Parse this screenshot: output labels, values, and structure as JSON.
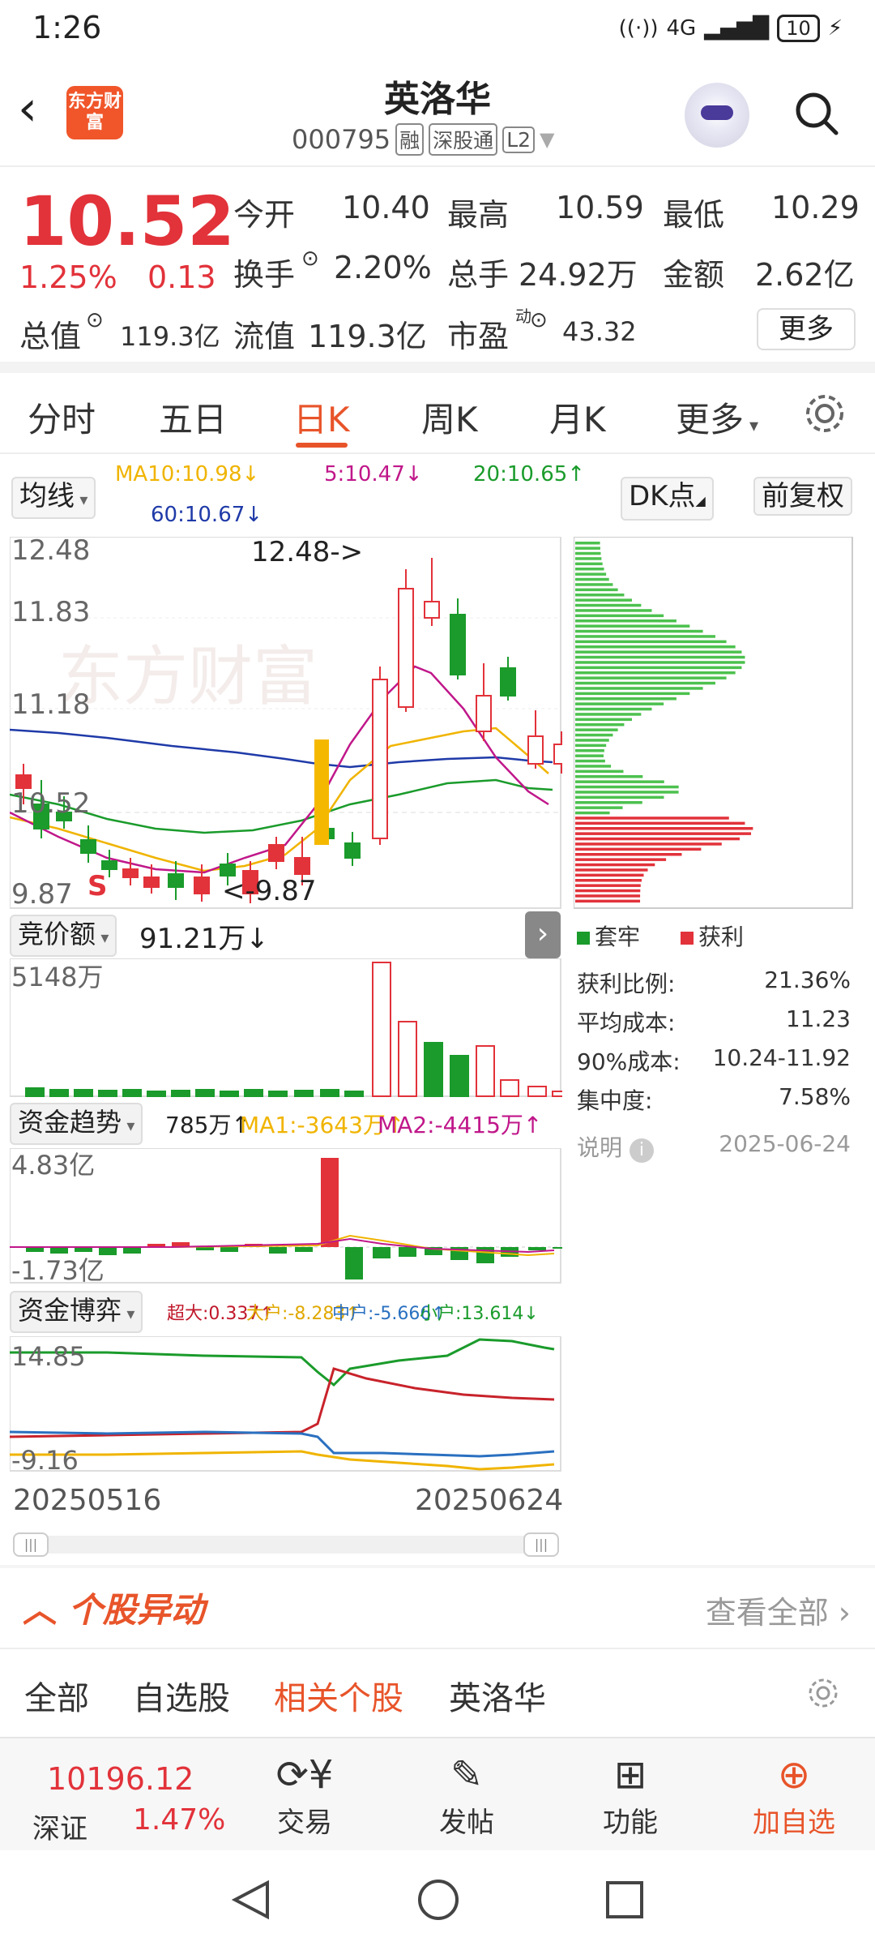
{
  "status_bar": {
    "time": "1:26",
    "network": "4G",
    "battery": "10"
  },
  "header": {
    "logo_text": "东方财富",
    "stock_name": "英洛华",
    "stock_code": "000795",
    "tags": [
      "融",
      "深股通",
      "L2"
    ]
  },
  "quote": {
    "price": "10.52",
    "change_pct": "1.25%",
    "change": "0.13",
    "open_label": "今开",
    "open": "10.40",
    "high_label": "最高",
    "high": "10.59",
    "low_label": "最低",
    "low": "10.29",
    "turnover_label": "换手",
    "turnover": "2.20%",
    "volume_label": "总手",
    "volume": "24.92万",
    "amount_label": "金额",
    "amount": "2.62亿",
    "mktcap_label": "总值",
    "mktcap": "119.3亿",
    "float_label": "流值",
    "float_cap": "119.3亿",
    "pe_label": "市盈",
    "pe_sup": "动",
    "pe": "43.32",
    "more_label": "更多"
  },
  "tabs": {
    "items": [
      "分时",
      "五日",
      "日K",
      "周K",
      "月K",
      "更多"
    ],
    "active": "日K"
  },
  "indicators": {
    "ma_selector": "均线",
    "ma10": "MA10:10.98↓",
    "ma5": "5:10.47↓",
    "ma20": "20:10.65↑",
    "ma60": "60:10.67↓",
    "dk_button": "DK点",
    "adjust_button": "前复权"
  },
  "kline": {
    "y_labels": [
      "12.48",
      "11.83",
      "11.18",
      "10.52",
      "9.87"
    ],
    "high_marker": "12.48->",
    "low_marker": "<-9.87",
    "s_marker": "S",
    "colors": {
      "up": "#e2323a",
      "down": "#1a9b2b",
      "ma5": "#c0178a",
      "ma10": "#f0b400",
      "ma20": "#1a9b2b",
      "ma60": "#1f3aa8"
    }
  },
  "auction": {
    "selector": "竞价额",
    "value": "91.21万↓"
  },
  "volume_panel": {
    "max_label": "5148万"
  },
  "fund_trend": {
    "selector": "资金趋势",
    "value": "785万↑",
    "ma1": "MA1:-3643万↑",
    "ma2": "MA2:-4415万↑",
    "top_label": "4.83亿",
    "bottom_label": "-1.73亿"
  },
  "fund_game": {
    "selector": "资金博弈",
    "super": "超大:0.337↑",
    "large": "大户:-8.283↑",
    "mid": "中户:-5.666↑",
    "small": "小户:13.614↓",
    "top_label": "14.85",
    "bottom_label": "-9.16"
  },
  "date_range": {
    "start": "20250516",
    "end": "20250624"
  },
  "chip": {
    "legend_trapped": "套牢",
    "legend_profit": "获利",
    "stats": [
      {
        "label": "获利比例:",
        "value": "21.36%"
      },
      {
        "label": "平均成本:",
        "value": "11.23"
      },
      {
        "label": "90%成本:",
        "value": "10.24-11.92"
      },
      {
        "label": "集中度:",
        "value": "7.58%"
      }
    ],
    "note_label": "说明",
    "date": "2025-06-24"
  },
  "movement": {
    "title": "个股异动",
    "see_all": "查看全部"
  },
  "filter_tabs": {
    "items": [
      "全部",
      "自选股",
      "相关个股",
      "英洛华"
    ],
    "active": "相关个股"
  },
  "bottom_bar": {
    "index_value": "10196.12",
    "index_name": "深证",
    "index_pct": "1.47%",
    "trade": "交易",
    "post": "发帖",
    "function": "功能",
    "add": "加自选"
  }
}
